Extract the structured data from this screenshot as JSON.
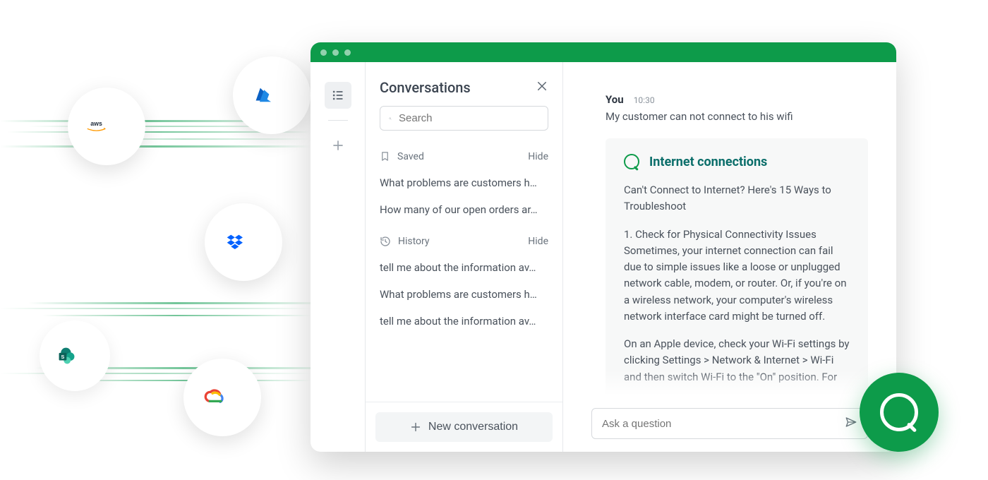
{
  "integrations": {
    "aws_label": "aws",
    "azure_label": "Azure",
    "dropbox_label": "Dropbox",
    "sharepoint_label": "SharePoint",
    "googlecloud_label": "Google Cloud"
  },
  "sidebar": {
    "title": "Conversations",
    "search_placeholder": "Search",
    "saved_label": "Saved",
    "saved_hide": "Hide",
    "saved_items": [
      "What problems are customers h…",
      "How many of our open orders ar…"
    ],
    "history_label": "History",
    "history_hide": "Hide",
    "history_items": [
      "tell me about the information av…",
      "What problems are customers h…",
      "tell me about the information av…"
    ],
    "new_conversation": "New conversation"
  },
  "chat": {
    "you_label": "You",
    "time": "10:30",
    "user_message": "My customer can not connect to his wifi",
    "answer_title": "Internet connections",
    "answer_p1": "Can't Connect to Internet? Here's 15 Ways to Troubleshoot",
    "answer_p2": "1. Check for Physical Connectivity Issues Sometimes, your internet connection can fail due to simple issues like a loose or unplugged network cable, modem, or router. Or, if you're on a wireless network, your computer's wireless network interface card might be turned off.",
    "answer_p3": "On an Apple device, check your Wi-Fi settings by clicking Settings > Network & Internet > Wi-Fi and then switch Wi-Fi to the \"On\" position. For",
    "input_placeholder": "Ask a question"
  }
}
